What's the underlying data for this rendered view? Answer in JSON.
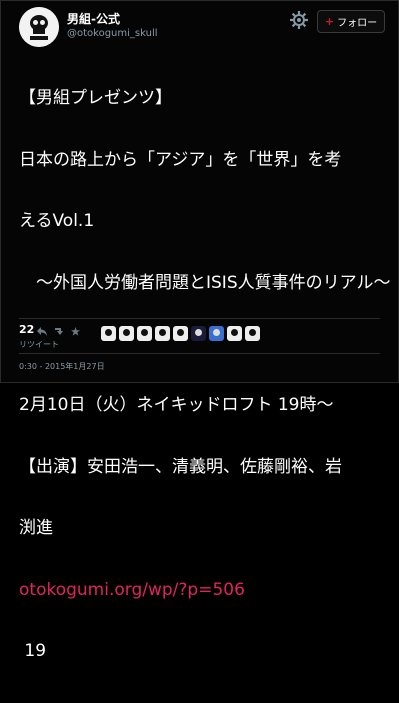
{
  "user": {
    "display_name": "男組-公式",
    "screen_name": "@otokogumi_skull",
    "avatar": "skull-logo",
    "follow_label": "フォロー",
    "follow_plus": "+"
  },
  "tweet": {
    "lines": [
      "【男組プレゼンツ】",
      "日本の路上から「アジア」を「世界」を考",
      "えるVol.1",
      "　～外国人労働者問題とISIS人質事件のリアル～",
      "",
      "2月10日（火）ネイキッドロフト 19時～",
      "【出演】安田浩一、清義明、佐藤剛裕、岩",
      "渕進"
    ],
    "link": "otokogumi.org/wp/?p=506",
    "trailing": " 19"
  },
  "stats": {
    "retweet_count": "22",
    "retweet_label": "リツイート"
  },
  "timestamp": "0:30 - 2015年1月27日",
  "icons": [
    "settings-gear-icon",
    "reply-icon",
    "retweet-icon",
    "favorite-icon",
    "more-icon"
  ],
  "colors": {
    "link": "#e0245e",
    "follow_plus": "#c31f31",
    "muted": "#8899a6"
  }
}
